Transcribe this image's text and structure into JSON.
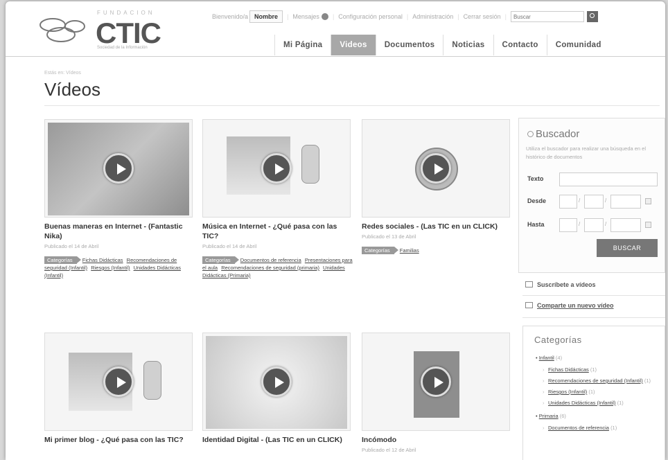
{
  "header": {
    "logo": {
      "top": "FUNDACION",
      "word": "CTIC",
      "tagline": "Sociedad de la Información"
    },
    "topbar": {
      "welcome": "Bienvenido/a",
      "user": "Nombre",
      "messages": "Mensajes",
      "personal_config": "Configuración personal",
      "admin": "Administración",
      "logout": "Cerrar sesión",
      "search_placeholder": "Buscar"
    },
    "nav": [
      "Mi Página",
      "Videos",
      "Documentos",
      "Noticias",
      "Contacto",
      "Comunidad"
    ],
    "active_nav": "Videos"
  },
  "main": {
    "breadcrumb": "Estás en: Vídeos",
    "title": "Vídeos",
    "videos": [
      {
        "title": "Buenas maneras en Internet - (Fantastic Nika)",
        "date": "Publicado el 14 de Abril",
        "category_label": "Categorías",
        "categories": [
          "Fichas Didácticas",
          "Recomendaciones de seguridad (Infantil)",
          "Riesgos (Infantil)",
          "Unidades Didácticas (Infantil)"
        ]
      },
      {
        "title": "Música en Internet - ¿Qué pasa con las TIC?",
        "date": "Publicado el 14 de Abril",
        "category_label": "Categorías",
        "categories": [
          "Documentos de referencia",
          "Presentaciones para el aula",
          "Recomendaciones de seguridad (primaria)",
          "Unidades Didácticas (Primaria)"
        ]
      },
      {
        "title": "Redes sociales - (Las TIC en un CLICK)",
        "date": "Publicado el 13 de Abril",
        "category_label": "Categorías",
        "categories": [
          "Familias"
        ]
      },
      {
        "title": "Mi primer blog - ¿Qué pasa con las TIC?",
        "date": ""
      },
      {
        "title": "Identidad Digital - (Las TIC en un CLICK)",
        "date": ""
      },
      {
        "title": "Incómodo",
        "date": "Publicado el 12 de Abril"
      }
    ]
  },
  "sidebar": {
    "search": {
      "title": "Buscador",
      "description": "Utiliza el buscador para realizar una búsqueda en el histórico de documentos",
      "text_label": "Texto",
      "from_label": "Desde",
      "to_label": "Hasta",
      "button": "BUSCAR"
    },
    "subscribe": "Suscríbete a vídeos",
    "share": "Comparte un nuevo vídeo",
    "categories_title": "Categorías",
    "categories": {
      "infantil": {
        "label": "Infantil",
        "count": "(4)"
      },
      "infantil_children": [
        {
          "label": "Fichas Didácticas",
          "count": "(1)"
        },
        {
          "label": "Recomendaciones de seguridad (Infantil)",
          "count": "(1)"
        },
        {
          "label": "Riesgos (Infantil)",
          "count": "(1)"
        },
        {
          "label": "Unidades Didácticas (Infantil)",
          "count": "(1)"
        }
      ],
      "primaria": {
        "label": "Primaria",
        "count": "(6)"
      },
      "primaria_children": [
        {
          "label": "Documentos de referencia",
          "count": "(1)"
        }
      ]
    }
  },
  "colors": {
    "accent": "#a8a8a8",
    "button": "#777777"
  }
}
